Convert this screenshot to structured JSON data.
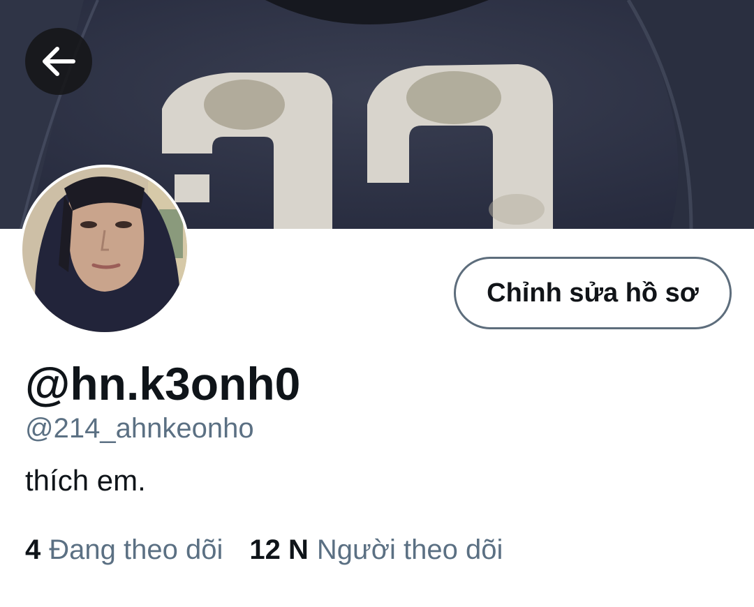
{
  "profile": {
    "display_name": "@hn.k3onh0",
    "handle": "@214_ahnkeonho",
    "bio": "thích em.",
    "edit_button_label": "Chỉnh sửa hồ sơ"
  },
  "stats": {
    "following_count": "4",
    "following_label": "Đang theo dõi",
    "followers_count": "12 N",
    "followers_label": "Người theo dõi"
  },
  "icons": {
    "back": "arrow-left-icon"
  },
  "colors": {
    "text_primary": "#0f1419",
    "text_secondary": "#5b7083",
    "button_border": "#5d6d7c",
    "banner_dark": "#2b3040"
  }
}
